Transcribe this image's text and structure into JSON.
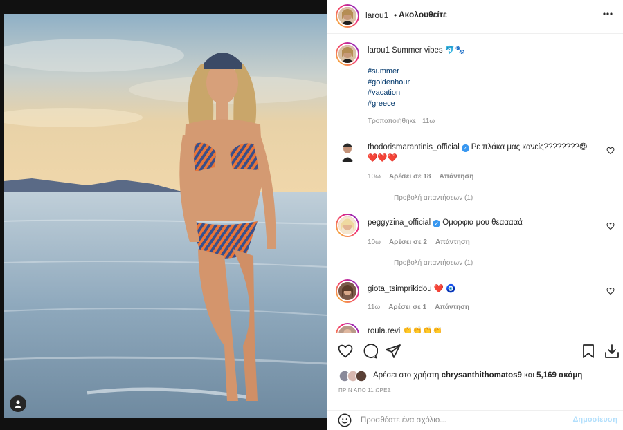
{
  "post": {
    "username": "larou1",
    "follow_label": "Ακολουθείτε",
    "dot": "•",
    "caption_text": "Summer vibes 🐬🐾",
    "hashtags": [
      "#summer",
      "#goldenhour",
      "#vacation",
      "#greece"
    ],
    "caption_meta": "Τροποποιήθηκε · 11ω"
  },
  "comments": [
    {
      "username": "thodorismarantinis_official",
      "verified": true,
      "text": "Ρε πλάκα μας κανείς????????😍",
      "text2": "❤️❤️❤️",
      "age": "10ω",
      "likes_label": "Αρέσει σε 18",
      "reply_label": "Απάντηση",
      "view_replies": "Προβολή απαντήσεων (1)"
    },
    {
      "username": "peggyzina_official",
      "verified": true,
      "text": "Ομορφια μου θεααααά",
      "age": "10ω",
      "likes_label": "Αρέσει σε 2",
      "reply_label": "Απάντηση",
      "view_replies": "Προβολή απαντήσεων (1)"
    },
    {
      "username": "giota_tsimprikidou",
      "verified": false,
      "text": "❤️ 🧿",
      "age": "11ω",
      "likes_label": "Αρέσει σε 1",
      "reply_label": "Απάντηση"
    },
    {
      "username": "roula.revi",
      "verified": false,
      "text": "👏👏👏👏"
    }
  ],
  "likes": {
    "prefix": "Αρέσει στο χρήστη",
    "user": "chrysanthithomatos9",
    "conjunction": "και",
    "others": "5,169 ακόμη"
  },
  "timestamp": "ΠΡΙΝ ΑΠΟ 11 ΩΡΕΣ",
  "comment_box": {
    "placeholder": "Προσθέστε ένα σχόλιο...",
    "post_label": "Δημοσίευση"
  },
  "icons": {
    "more": "more-icon",
    "like": "heart-icon",
    "comment": "comment-icon",
    "share": "paper-plane-icon",
    "save": "bookmark-icon",
    "download": "download-icon",
    "emoji": "smiley-icon",
    "user_tag": "user-tag-icon"
  },
  "colors": {
    "link": "#00376b",
    "verified": "#3897f0",
    "muted": "#8e8e8e",
    "post_disabled": "#b2dffc"
  }
}
